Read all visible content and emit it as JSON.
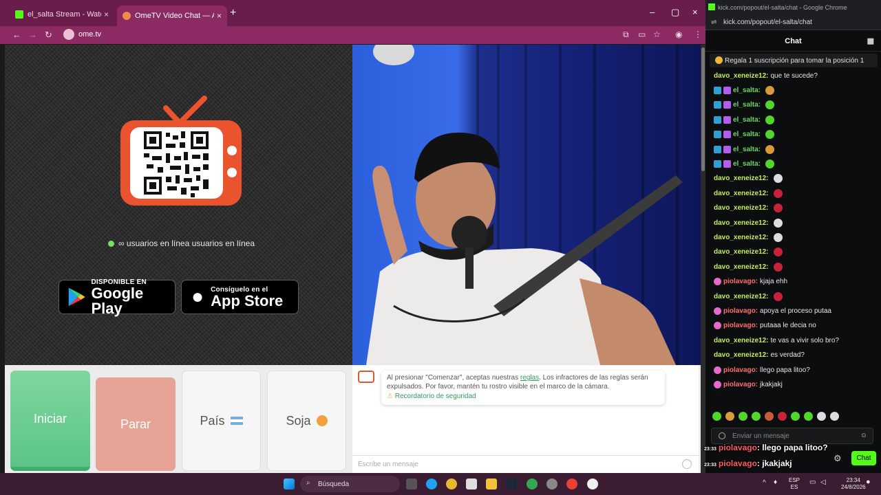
{
  "browser": {
    "tabs": [
      {
        "title": "el_salta Stream - Watch Live on Kick",
        "close": "×"
      },
      {
        "title": "OmeTV Video Chat — Alternative",
        "close": "×"
      }
    ],
    "new_tab": "+",
    "url": "ome.tv",
    "controls": {
      "minimize": "–",
      "maximize": "▢",
      "close": "×"
    }
  },
  "ometv": {
    "online_text": "∞ usuarios en línea usuarios en línea",
    "google_play": {
      "small": "DISPONIBLE EN",
      "big": "Google Play"
    },
    "app_store": {
      "small": "Consíguelo en el",
      "big": "App Store"
    },
    "buttons": {
      "start": "Iniciar",
      "stop": "Parar",
      "country": "País",
      "gender": "Soja"
    },
    "notice": {
      "text_before": "Al presionar \"Comenzar\", aceptas nuestras ",
      "link": "reglas",
      "text_after": ". Los infractores de las reglas serán expulsados. Por favor, mantén tu rostro visible en el marco de la cámara.",
      "safety": "Recordatorio de seguridad"
    },
    "message_placeholder": "Escribe un mensaje"
  },
  "kick": {
    "window_title": "kick.com/popout/el-salta/chat - Google Chrome",
    "url": "kick.com/popout/el-salta/chat",
    "header": "Chat",
    "pinned": "Regala 1 suscripción para tomar la posición 1",
    "messages": [
      {
        "user": "davo_xeneize12:",
        "text": "que te sucede?",
        "color": "#c6ef5c"
      },
      {
        "user": "el_salta:",
        "text": "",
        "color": "#6fd36a",
        "badges": true,
        "emote": "#d99a3a"
      },
      {
        "user": "el_salta:",
        "text": "",
        "color": "#6fd36a",
        "badges": true,
        "emote": "#53d62c"
      },
      {
        "user": "el_salta:",
        "text": "",
        "color": "#6fd36a",
        "badges": true,
        "emote": "#53d62c"
      },
      {
        "user": "el_salta:",
        "text": "",
        "color": "#6fd36a",
        "badges": true,
        "emote": "#53d62c"
      },
      {
        "user": "el_salta:",
        "text": "",
        "color": "#6fd36a",
        "badges": true,
        "emote": "#d99a3a"
      },
      {
        "user": "el_salta:",
        "text": "",
        "color": "#6fd36a",
        "badges": true,
        "emote": "#53d62c"
      },
      {
        "user": "davo_xeneize12:",
        "text": "",
        "color": "#c6ef5c",
        "emote": "#dddddd"
      },
      {
        "user": "davo_xeneize12:",
        "text": "",
        "color": "#c6ef5c",
        "emote": "#c6233a"
      },
      {
        "user": "davo_xeneize12:",
        "text": "",
        "color": "#c6ef5c",
        "emote": "#c6233a"
      },
      {
        "user": "davo_xeneize12:",
        "text": "",
        "color": "#c6ef5c",
        "emote": "#dddddd"
      },
      {
        "user": "davo_xeneize12:",
        "text": "",
        "color": "#c6ef5c",
        "emote": "#dddddd"
      },
      {
        "user": "davo_xeneize12:",
        "text": "",
        "color": "#c6ef5c",
        "emote": "#c6233a"
      },
      {
        "user": "davo_xeneize12:",
        "text": "",
        "color": "#c6ef5c",
        "emote": "#c6233a"
      },
      {
        "user": "piolavago:",
        "text": "kjaja ehh",
        "color": "#ff6f6f",
        "badge": "#e46acb"
      },
      {
        "user": "davo_xeneize12:",
        "text": "",
        "color": "#c6ef5c",
        "emote": "#c6233a"
      },
      {
        "user": "piolavago:",
        "text": "apoya el proceso putaa",
        "color": "#ff6f6f",
        "badge": "#e46acb"
      },
      {
        "user": "piolavago:",
        "text": "putaaa le decia no",
        "color": "#ff6f6f",
        "badge": "#e46acb"
      },
      {
        "user": "davo_xeneize12:",
        "text": "te vas a vivir solo bro?",
        "color": "#c6ef5c"
      },
      {
        "user": "davo_xeneize12:",
        "text": "es verdad?",
        "color": "#c6ef5c"
      },
      {
        "user": "piolavago:",
        "text": "llego papa litoo?",
        "color": "#ff6f6f",
        "badge": "#e46acb"
      },
      {
        "user": "piolavago:",
        "text": "jkakjakj",
        "color": "#ff6f6f",
        "badge": "#e46acb"
      }
    ],
    "emote_colors": [
      "#53d62c",
      "#d99a3a",
      "#53d62c",
      "#53d62c",
      "#c65a3a",
      "#c6233a",
      "#53d62c",
      "#53d62c",
      "#dddddd",
      "#dddddd"
    ],
    "input_placeholder": "Enviar un mensaje",
    "chat_button": "Chat",
    "overlay": [
      {
        "time": "23:33",
        "user": "piolavago",
        "text": ": llego papa litoo?"
      },
      {
        "time": "23:33",
        "user": "piolavago",
        "text": ": jkakjakj"
      }
    ]
  },
  "taskbar": {
    "search": "Búsqueda",
    "lang": "ESP",
    "lang2": "ES",
    "time": "23:34",
    "date": "24/8/2026"
  }
}
